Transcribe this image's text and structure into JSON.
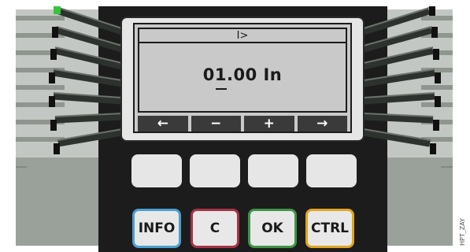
{
  "display": {
    "title": "I>",
    "value": "01.00 In",
    "softkeys": [
      "←",
      "−",
      "+",
      "→"
    ]
  },
  "keys": {
    "blank_count": 4,
    "labeled": [
      {
        "label": "INFO",
        "color": "#4aa0d0"
      },
      {
        "label": "C",
        "color": "#a63347"
      },
      {
        "label": "OK",
        "color": "#3f9446"
      },
      {
        "label": "CTRL",
        "color": "#e0a520"
      }
    ]
  },
  "leds": {
    "left_top_color": "#38c43a"
  },
  "colors": {
    "panel": "#1c1c1c",
    "side": "#b8bdb8",
    "lcd": "#c9c9c9"
  },
  "watermark": "HPT_ZAY"
}
